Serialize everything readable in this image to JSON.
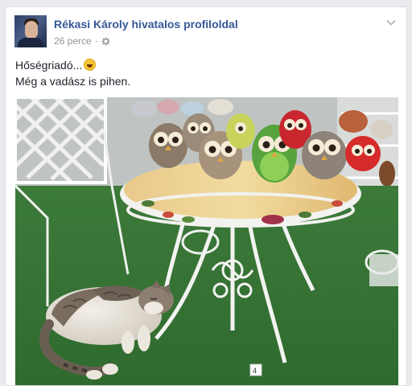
{
  "post": {
    "author": "Rékasi Károly hivatalos profiloldal",
    "time": "26 perce",
    "separator": "·",
    "audience_icon": "gear-icon",
    "text_line1": "Hőségriadó...",
    "text_emoji": "laughing-tears-emoji",
    "text_line2": "Még a vadász is pihen.",
    "options_icon": "chevron-down-icon"
  },
  "photo": {
    "tag_text": "4"
  }
}
